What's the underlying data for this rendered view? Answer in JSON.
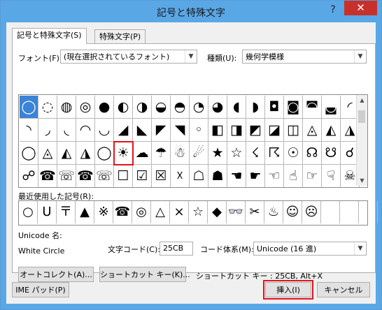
{
  "window": {
    "title": "記号と特殊文字",
    "help_label": "?",
    "close_label": "✕"
  },
  "tabs": [
    {
      "label": "記号と特殊文字(S)"
    },
    {
      "label": "特殊文字(P)"
    }
  ],
  "font": {
    "label": "フォント(F):",
    "value": "(現在選択されているフォント)"
  },
  "subset": {
    "label": "種類(U):",
    "value": "幾何学模様"
  },
  "symbol_rows": [
    [
      "◯",
      "◌",
      "◍",
      "◎",
      "●",
      "◐",
      "◑",
      "◒",
      "◓",
      "◔",
      "◕",
      "◖",
      "◗",
      "◘",
      "◙",
      "◚",
      "◛",
      "◜"
    ],
    [
      "◝",
      "◞",
      "◟",
      "◠",
      "◡",
      "◢",
      "◣",
      "◤",
      "◥",
      "◦",
      "◧",
      "◨",
      "◩",
      "◪",
      "◫",
      "◬",
      "◭",
      "◮"
    ],
    [
      "◯",
      "◬",
      "◭",
      "◮",
      "◯",
      "☀",
      "☁",
      "☂",
      "☃",
      "☄",
      "★",
      "☆",
      "☇",
      "☈",
      "☉",
      "☊",
      "☋",
      "☌"
    ],
    [
      "☍",
      "☎",
      "☏",
      "☎",
      "☏",
      "☐",
      "☑",
      "☒",
      "☓",
      "☖",
      "☗",
      "☚",
      "☛",
      "☜",
      "☝",
      "☞",
      "☟",
      "☠"
    ]
  ],
  "recent": {
    "label": "最近使用した記号(R):",
    "items": [
      "○",
      "U",
      "〒",
      "▲",
      "※",
      "☎",
      "◎",
      "△",
      "×",
      "☆",
      "◆",
      "👓",
      "✂",
      "♨",
      "☺",
      "☹",
      "",
      "",
      ""
    ]
  },
  "unicode_name": {
    "label": "Unicode 名:",
    "value": "White Circle"
  },
  "char_code": {
    "label": "文字コード(C):",
    "value": "25CB"
  },
  "from": {
    "label": "コード体系(M):",
    "value": "Unicode (16 進)"
  },
  "autocorrect_label": "オートコレクト(A)...",
  "shortcut_label": "ショートカット キー(K)...",
  "shortcut_info": "ショートカット キー : 25CB, Alt+X",
  "ime_label": "IME パッド(P)",
  "insert_label": "挿入(I)",
  "cancel_label": "キャンセル"
}
